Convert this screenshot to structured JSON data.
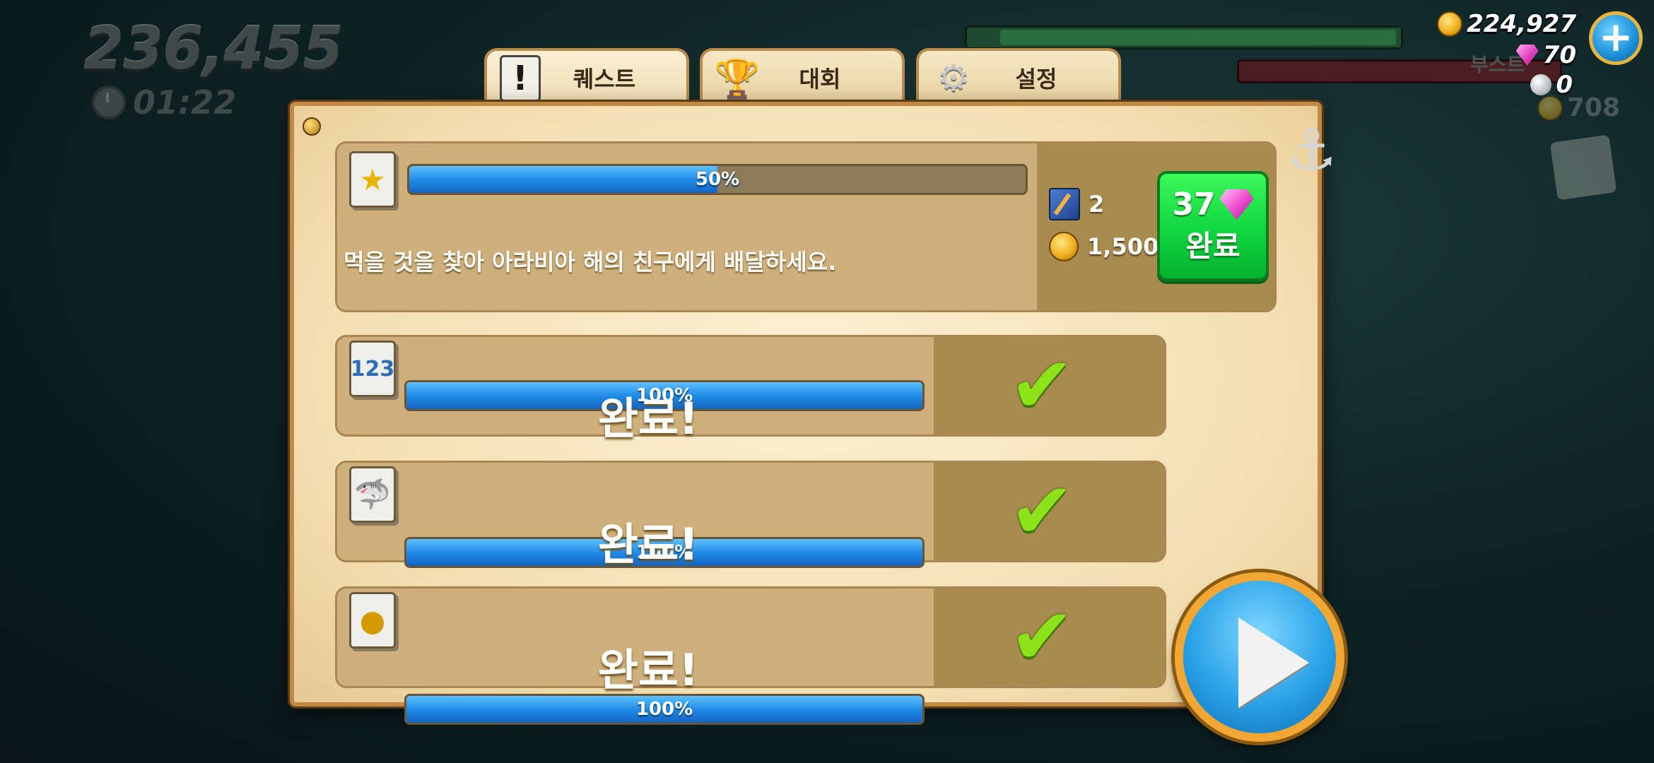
{
  "hud": {
    "score": "236,455",
    "timer": "01:22",
    "coins": "224,927",
    "gems": "70",
    "pearls": "0",
    "coins_faded": "708",
    "boost_label": "부스트",
    "plus_label": "+"
  },
  "tabs": [
    {
      "label": "퀘스트",
      "icon": "quest-icon"
    },
    {
      "label": "대회",
      "icon": "trophy-icon"
    },
    {
      "label": "설정",
      "icon": "gear-icon"
    }
  ],
  "quests": [
    {
      "icon": "star-icon",
      "progress": 0.5,
      "progress_label": "50%",
      "description": "먹을 것을 찾아 아라비아 해의 친구에게 배달하세요.",
      "reward_tome": "2",
      "reward_coins": "1,500",
      "complete_cost": "37",
      "complete_label": "완료"
    },
    {
      "icon": "numbers-icon",
      "progress": 1.0,
      "progress_label": "100%",
      "status": "완료!"
    },
    {
      "icon": "shark-icon",
      "progress": 1.0,
      "progress_label": "100%",
      "status": "완료!"
    },
    {
      "icon": "coins-icon",
      "progress": 1.0,
      "progress_label": "100%",
      "status": "완료!"
    }
  ],
  "colors": {
    "progress_blue": "#1e88e5",
    "complete_green": "#10d640",
    "parchment": "#f3deb0",
    "checkmark": "#8de31a"
  }
}
